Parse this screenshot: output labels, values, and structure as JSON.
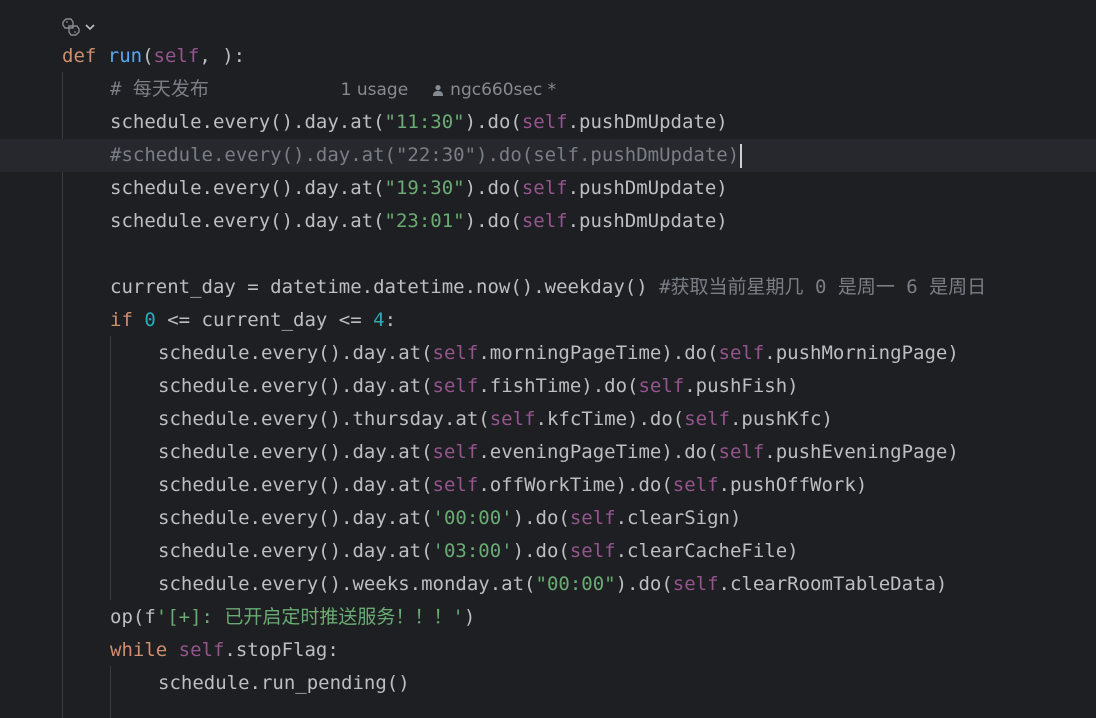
{
  "editor": {
    "language": "python",
    "lines": [
      {
        "tokens": [
          [
            "kw",
            "def "
          ],
          [
            "fn",
            "run"
          ],
          [
            "plain",
            "("
          ],
          [
            "slf",
            "self"
          ],
          [
            "plain",
            ", ):"
          ]
        ]
      },
      {
        "tokens": [
          [
            "cmt",
            "# 每天发布"
          ]
        ]
      },
      {
        "tokens": [
          [
            "plain",
            "schedule.every().day.at("
          ],
          [
            "str",
            "\"11:30\""
          ],
          [
            "plain",
            ").do("
          ],
          [
            "slf",
            "self"
          ],
          [
            "plain",
            ".pushDmUpdate)"
          ]
        ]
      },
      {
        "tokens": [
          [
            "cmt",
            "#schedule.every().day.at(\"22:30\").do(self.pushDmUpdate)"
          ]
        ]
      },
      {
        "tokens": [
          [
            "plain",
            "schedule.every().day.at("
          ],
          [
            "str",
            "\"19:30\""
          ],
          [
            "plain",
            ").do("
          ],
          [
            "slf",
            "self"
          ],
          [
            "plain",
            ".pushDmUpdate)"
          ]
        ]
      },
      {
        "tokens": [
          [
            "plain",
            "schedule.every().day.at("
          ],
          [
            "str",
            "\"23:01\""
          ],
          [
            "plain",
            ").do("
          ],
          [
            "slf",
            "self"
          ],
          [
            "plain",
            ".pushDmUpdate)"
          ]
        ]
      },
      {
        "tokens": []
      },
      {
        "tokens": [
          [
            "plain",
            "current_day = datetime.datetime.now().weekday() "
          ],
          [
            "cmt",
            "#获取当前星期几 0 是周一 6 是周日"
          ]
        ]
      },
      {
        "tokens": [
          [
            "kw",
            "if "
          ],
          [
            "num",
            "0"
          ],
          [
            "plain",
            " <= current_day <= "
          ],
          [
            "num",
            "4"
          ],
          [
            "plain",
            ":"
          ]
        ]
      },
      {
        "tokens": [
          [
            "plain",
            "schedule.every().day.at("
          ],
          [
            "slf",
            "self"
          ],
          [
            "plain",
            ".morningPageTime).do("
          ],
          [
            "slf",
            "self"
          ],
          [
            "plain",
            ".pushMorningPage)"
          ]
        ]
      },
      {
        "tokens": [
          [
            "plain",
            "schedule.every().day.at("
          ],
          [
            "slf",
            "self"
          ],
          [
            "plain",
            ".fishTime).do("
          ],
          [
            "slf",
            "self"
          ],
          [
            "plain",
            ".pushFish)"
          ]
        ]
      },
      {
        "tokens": [
          [
            "plain",
            "schedule.every().thursday.at("
          ],
          [
            "slf",
            "self"
          ],
          [
            "plain",
            ".kfcTime).do("
          ],
          [
            "slf",
            "self"
          ],
          [
            "plain",
            ".pushKfc)"
          ]
        ]
      },
      {
        "tokens": [
          [
            "plain",
            "schedule.every().day.at("
          ],
          [
            "slf",
            "self"
          ],
          [
            "plain",
            ".eveningPageTime).do("
          ],
          [
            "slf",
            "self"
          ],
          [
            "plain",
            ".pushEveningPage)"
          ]
        ]
      },
      {
        "tokens": [
          [
            "plain",
            "schedule.every().day.at("
          ],
          [
            "slf",
            "self"
          ],
          [
            "plain",
            ".offWorkTime).do("
          ],
          [
            "slf",
            "self"
          ],
          [
            "plain",
            ".pushOffWork)"
          ]
        ]
      },
      {
        "tokens": [
          [
            "plain",
            "schedule.every().day.at("
          ],
          [
            "str",
            "'00:00'"
          ],
          [
            "plain",
            ").do("
          ],
          [
            "slf",
            "self"
          ],
          [
            "plain",
            ".clearSign)"
          ]
        ]
      },
      {
        "tokens": [
          [
            "plain",
            "schedule.every().day.at("
          ],
          [
            "str",
            "'03:00'"
          ],
          [
            "plain",
            ").do("
          ],
          [
            "slf",
            "self"
          ],
          [
            "plain",
            ".clearCacheFile)"
          ]
        ]
      },
      {
        "tokens": [
          [
            "plain",
            "schedule.every().weeks.monday.at("
          ],
          [
            "str",
            "\"00:00\""
          ],
          [
            "plain",
            ").do("
          ],
          [
            "slf",
            "self"
          ],
          [
            "plain",
            ".clearRoomTableData)"
          ]
        ]
      },
      {
        "tokens": [
          [
            "plain",
            "op(f"
          ],
          [
            "str",
            "'[+]: 已开启定时推送服务！！！'"
          ],
          [
            "plain",
            ")"
          ]
        ]
      },
      {
        "tokens": [
          [
            "kw",
            "while "
          ],
          [
            "slf",
            "self"
          ],
          [
            "plain",
            ".stopFlag:"
          ]
        ]
      },
      {
        "tokens": [
          [
            "plain",
            "schedule.run_pending()"
          ]
        ]
      }
    ]
  },
  "inlay": {
    "usage": "1 usage",
    "author": "ngc660sec *"
  },
  "icons": {
    "fold": "python-fold-icon",
    "intention": "lightbulb-icon",
    "author": "person-icon"
  },
  "colors": {
    "background": "#1e1f22",
    "current_line": "#26282e",
    "keyword": "#cf8e6d",
    "function": "#56a8f5",
    "self": "#94558d",
    "string": "#6aab73",
    "number": "#2aacb8",
    "comment": "#7a7e85",
    "text": "#bcbec4",
    "bulb": "#f2c55c"
  }
}
